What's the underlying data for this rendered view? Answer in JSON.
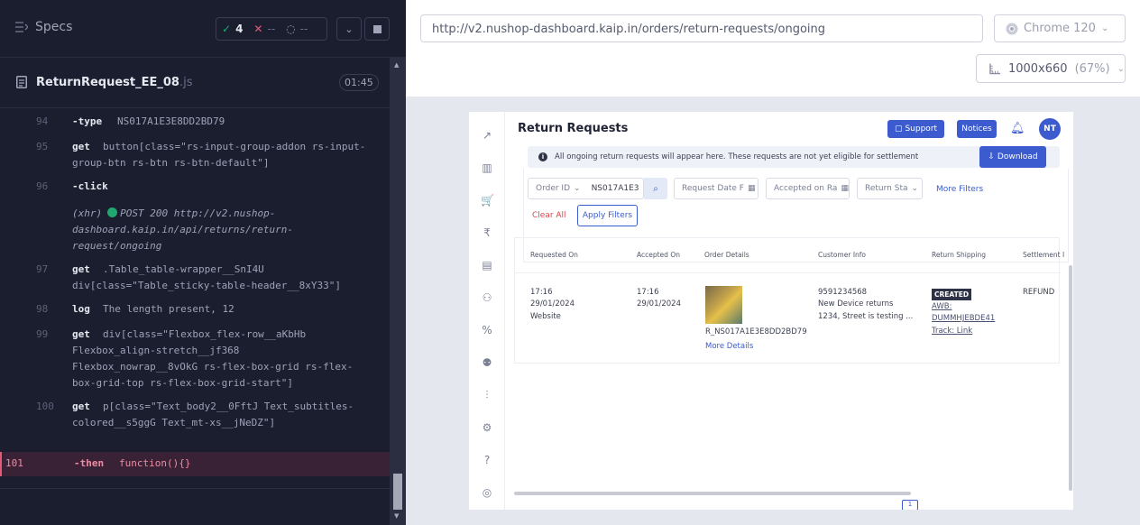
{
  "specs_bar": {
    "title": "Specs",
    "passed_count": "4",
    "failed_count": "--",
    "pending_count": "--"
  },
  "file": {
    "name": "ReturnRequest_EE_08",
    "ext": ".js",
    "time": "01:45"
  },
  "commands": [
    {
      "line": "94",
      "name": "-type",
      "message": "NS017A1E3E8DD2BD79"
    },
    {
      "line": "95",
      "name": "get",
      "message": "button[class=\"rs-input-group-addon rs-input-group-btn rs-btn rs-btn-default\"]"
    },
    {
      "line": "96",
      "name": "-click",
      "message": ""
    },
    {
      "line": "",
      "name": "(xhr)",
      "message": "POST 200 http://v2.nushop-dashboard.kaip.in/api/returns/return-request/ongoing"
    },
    {
      "line": "97",
      "name": "get",
      "message": ".Table_table-wrapper__SnI4U div[class=\"Table_sticky-table-header__8xY33\"]"
    },
    {
      "line": "98",
      "name": "log",
      "message": "The length present, 12"
    },
    {
      "line": "99",
      "name": "get",
      "message": "div[class=\"Flexbox_flex-row__aKbHb Flexbox_align-stretch__jf368 Flexbox_nowrap__8vOkG rs-flex-box-grid rs-flex-box-grid-top rs-flex-box-grid-start\"]"
    },
    {
      "line": "100",
      "name": "get",
      "message": "p[class=\"Text_body2__0FftJ Text_subtitles-colored__s5ggG Text_mt-xs__jNeDZ\"]"
    },
    {
      "line": "101",
      "name": "-then",
      "message": "function(){}"
    }
  ],
  "browser_bar": {
    "url": "http://v2.nushop-dashboard.kaip.in/orders/return-requests/ongoing",
    "browser": "Chrome 120",
    "viewport": "1000x660",
    "zoom": "(67%)"
  },
  "app": {
    "title": "Return Requests",
    "support_label": "Support",
    "notices_label": "Notices",
    "avatar_initials": "NT",
    "info_text": "All ongoing return requests will appear here. These requests are not yet eligible for settlement",
    "download_label": "Download",
    "filters": {
      "order_id_label": "Order ID",
      "order_id_value": "NS017A1E3",
      "request_date_placeholder": "Request Date F",
      "accepted_on_placeholder": "Accepted on Ra",
      "return_status_placeholder": "Return Sta",
      "more_filters": "More Filters",
      "clear_all": "Clear All",
      "apply_filters": "Apply Filters"
    },
    "table": {
      "columns": [
        "Requested On",
        "Accepted On",
        "Order Details",
        "Customer Info",
        "Return Shipping",
        "Settlement I"
      ],
      "row": {
        "requested_time": "17:16",
        "requested_date": "29/01/2024",
        "requested_channel": "Website",
        "accepted_time": "17:16",
        "accepted_date": "29/01/2024",
        "order_id": "R_NS017A1E3E8DD2BD79",
        "more_details": "More Details",
        "customer_phone": "9591234568",
        "customer_note": "New Device returns",
        "customer_address": "1234, Street is testing ...",
        "shipping_status": "CREATED",
        "awb_label": "AWB:",
        "awb_value": "DUMMHJEBDE41",
        "track_link": "Track: Link",
        "settlement": "REFUND"
      }
    },
    "pager_current": "1"
  }
}
